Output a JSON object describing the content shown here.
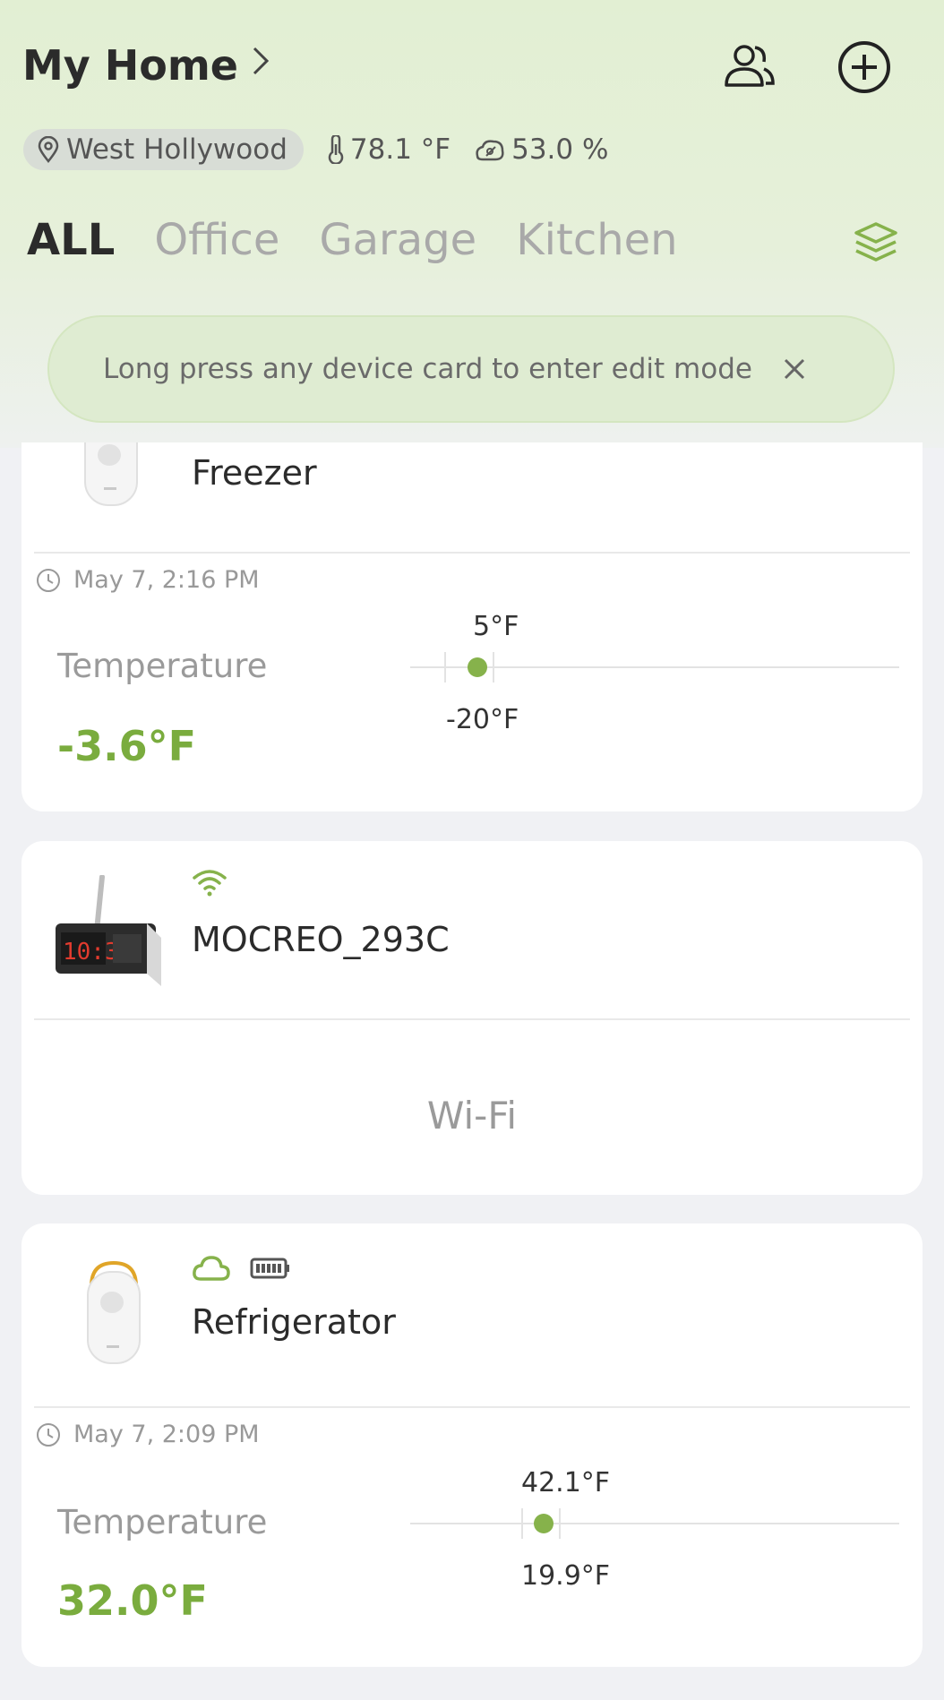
{
  "header": {
    "title": "My Home",
    "location": "West Hollywood",
    "temperature": "78.1 °F",
    "humidity": "53.0 %"
  },
  "tabs": [
    "ALL",
    "Office",
    "Garage",
    "Kitchen"
  ],
  "tip": {
    "text": "Long press any device card to enter edit mode"
  },
  "devices": [
    {
      "name": "Freezer",
      "time": "May 7, 2:16 PM",
      "label": "Temperature",
      "value": "-3.6°F",
      "high": "5°F",
      "low": "-20°F"
    },
    {
      "name": "MOCREO_293C",
      "connection": "Wi-Fi"
    },
    {
      "name": "Refrigerator",
      "time": "May 7, 2:09 PM",
      "label": "Temperature",
      "value": "32.0°F",
      "high": "42.1°F",
      "low": "19.9°F"
    }
  ],
  "colors": {
    "accent": "#86b24b",
    "value_green": "#7aac3e",
    "header_bg": "#e2efd3"
  },
  "icons": [
    "chevron-right-icon",
    "members-icon",
    "add-circle-icon",
    "location-pin-icon",
    "thermometer-icon",
    "humidity-icon",
    "layers-icon",
    "close-icon",
    "clock-icon",
    "wifi-icon",
    "cloud-icon",
    "battery-icon"
  ]
}
